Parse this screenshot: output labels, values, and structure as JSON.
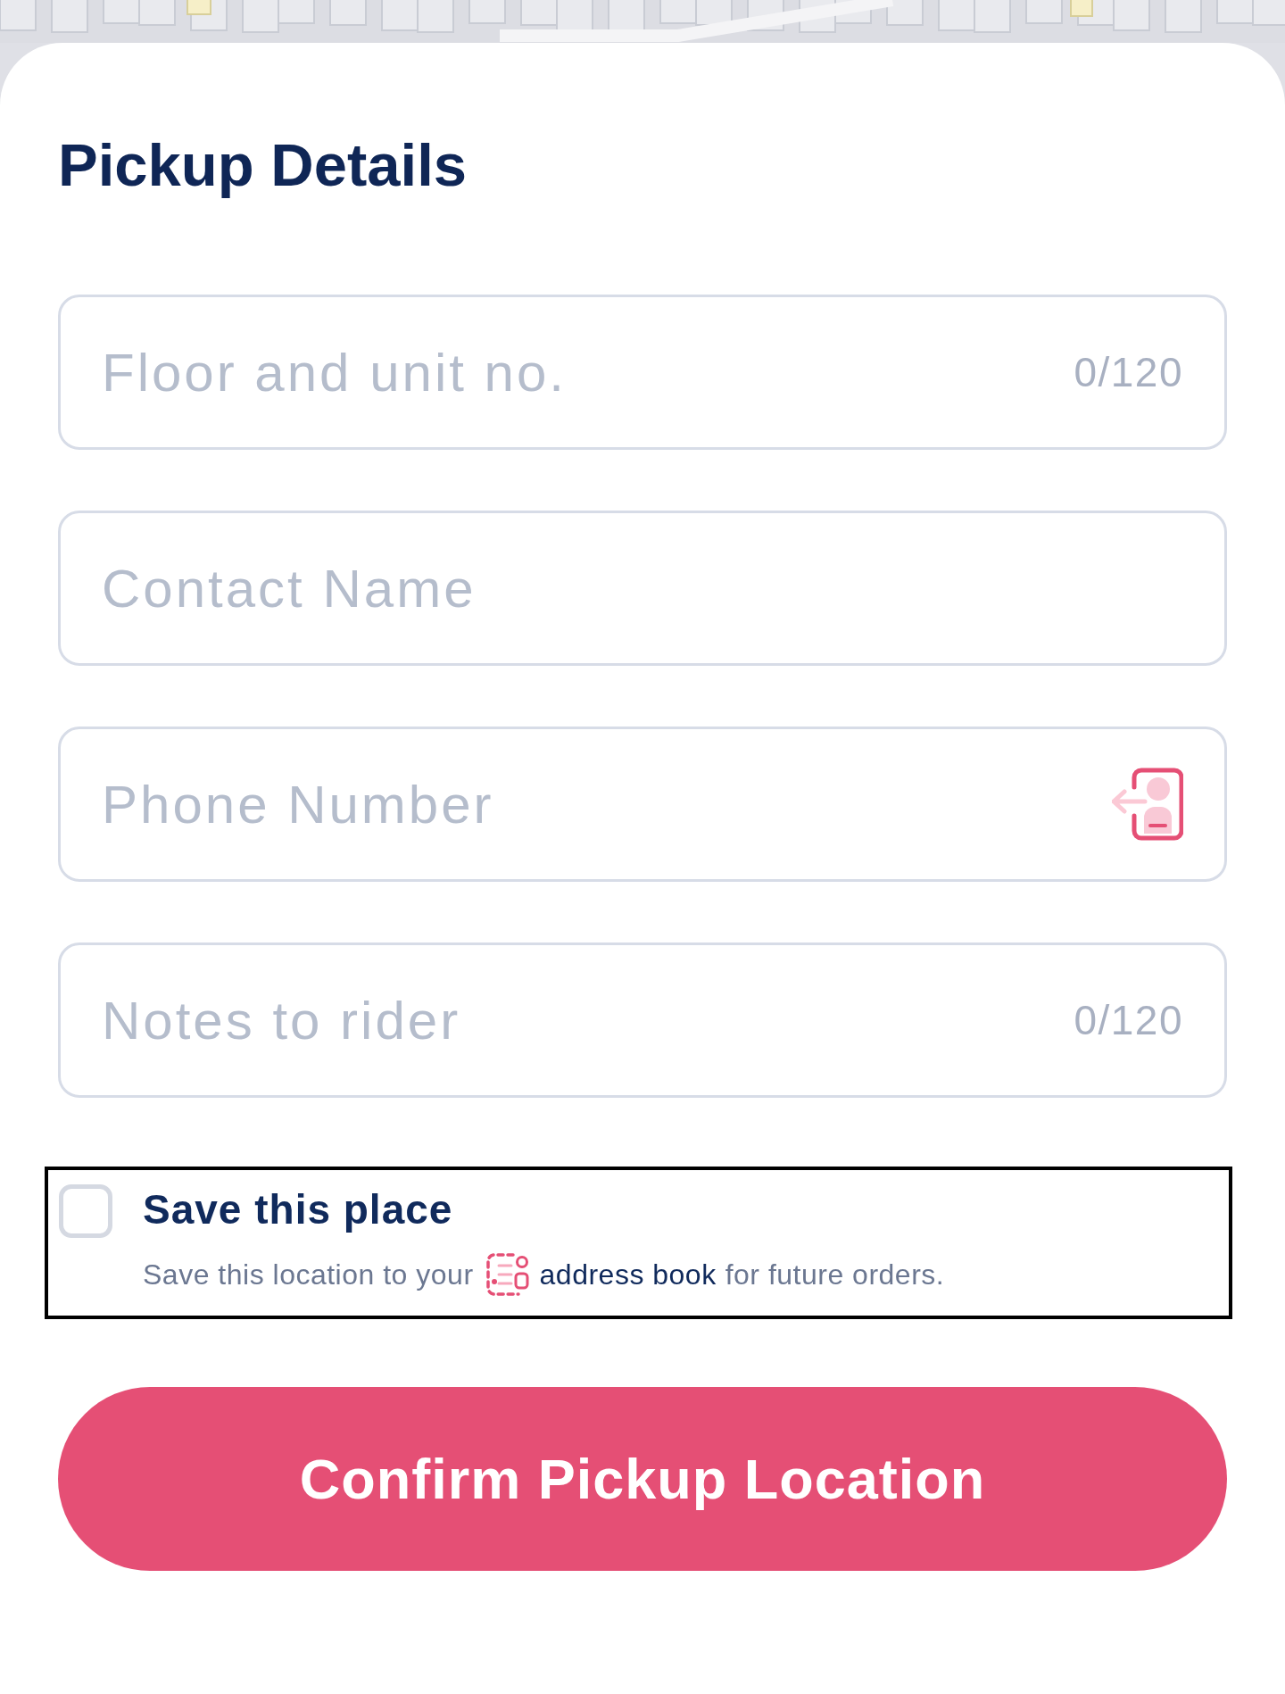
{
  "header": {
    "title": "Pickup Details"
  },
  "fields": [
    {
      "kind": "counter",
      "placeholder": "Floor and unit no.",
      "counter": "0/120"
    },
    {
      "kind": "plain",
      "placeholder": "Contact Name"
    },
    {
      "kind": "contact",
      "placeholder": "Phone Number"
    },
    {
      "kind": "counter",
      "placeholder": "Notes to rider",
      "counter": "0/120"
    }
  ],
  "save_option": {
    "highlighted": true,
    "checked": false,
    "label": "Save this place",
    "description": {
      "before": "Save this location to your",
      "link": "address book",
      "after": "for future orders."
    }
  },
  "confirm_button": {
    "label": "Confirm Pickup Location"
  }
}
